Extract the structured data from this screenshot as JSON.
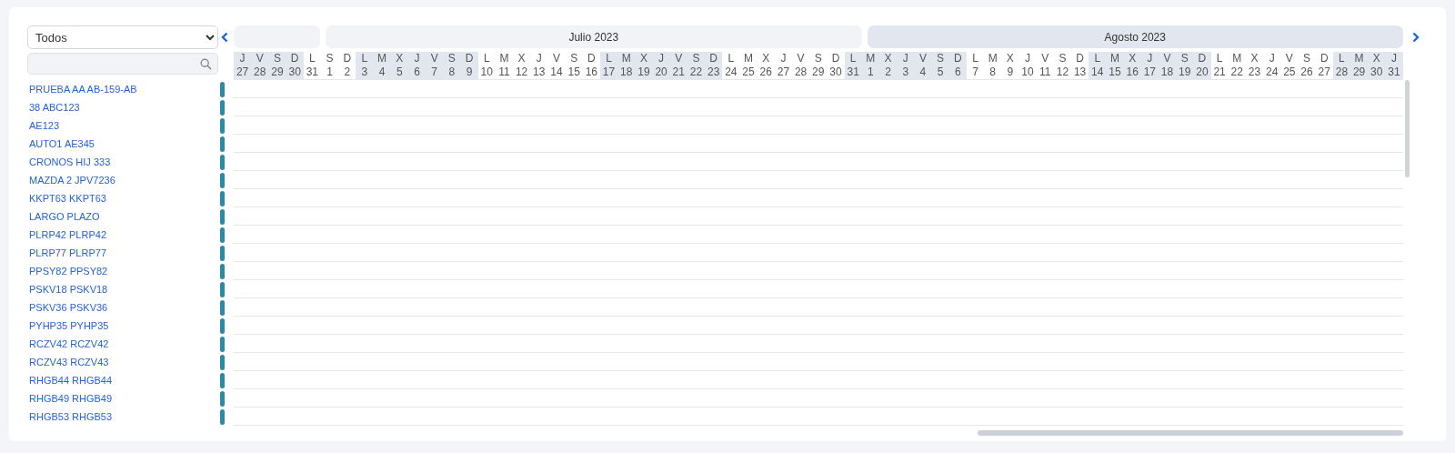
{
  "filter": {
    "value": "Todos"
  },
  "months": [
    {
      "selected": false
    },
    {
      "label": "Julio 2023",
      "selected": false
    },
    {
      "label": "Agosto 2023",
      "selected": true
    }
  ],
  "weeks": [
    {
      "shaded": true,
      "days": [
        {
          "weekday": "J",
          "day": "27"
        },
        {
          "weekday": "V",
          "day": "28"
        },
        {
          "weekday": "S",
          "day": "29"
        },
        {
          "weekday": "D",
          "day": "30"
        }
      ]
    },
    {
      "shaded": false,
      "days": [
        {
          "weekday": "L",
          "day": "31"
        },
        {
          "weekday": "S",
          "day": "1"
        },
        {
          "weekday": "D",
          "day": "2"
        }
      ]
    },
    {
      "shaded": true,
      "days": [
        {
          "weekday": "L",
          "day": "3"
        },
        {
          "weekday": "M",
          "day": "4"
        },
        {
          "weekday": "X",
          "day": "5"
        },
        {
          "weekday": "J",
          "day": "6"
        },
        {
          "weekday": "V",
          "day": "7"
        },
        {
          "weekday": "S",
          "day": "8"
        },
        {
          "weekday": "D",
          "day": "9"
        }
      ]
    },
    {
      "shaded": false,
      "days": [
        {
          "weekday": "L",
          "day": "10"
        },
        {
          "weekday": "M",
          "day": "11"
        },
        {
          "weekday": "X",
          "day": "12"
        },
        {
          "weekday": "J",
          "day": "13"
        },
        {
          "weekday": "V",
          "day": "14"
        },
        {
          "weekday": "S",
          "day": "15"
        },
        {
          "weekday": "D",
          "day": "16"
        }
      ]
    },
    {
      "shaded": true,
      "days": [
        {
          "weekday": "L",
          "day": "17"
        },
        {
          "weekday": "M",
          "day": "18"
        },
        {
          "weekday": "X",
          "day": "19"
        },
        {
          "weekday": "J",
          "day": "20"
        },
        {
          "weekday": "V",
          "day": "21"
        },
        {
          "weekday": "S",
          "day": "22"
        },
        {
          "weekday": "D",
          "day": "23"
        }
      ]
    },
    {
      "shaded": false,
      "days": [
        {
          "weekday": "L",
          "day": "24"
        },
        {
          "weekday": "M",
          "day": "25"
        },
        {
          "weekday": "X",
          "day": "26"
        },
        {
          "weekday": "J",
          "day": "27"
        },
        {
          "weekday": "V",
          "day": "28"
        },
        {
          "weekday": "S",
          "day": "29"
        },
        {
          "weekday": "D",
          "day": "30"
        }
      ]
    },
    {
      "shaded": true,
      "days": [
        {
          "weekday": "L",
          "day": "31"
        },
        {
          "weekday": "M",
          "day": "1"
        },
        {
          "weekday": "X",
          "day": "2"
        },
        {
          "weekday": "J",
          "day": "3"
        },
        {
          "weekday": "V",
          "day": "4"
        },
        {
          "weekday": "S",
          "day": "5"
        },
        {
          "weekday": "D",
          "day": "6"
        }
      ]
    },
    {
      "shaded": false,
      "days": [
        {
          "weekday": "L",
          "day": "7"
        },
        {
          "weekday": "M",
          "day": "8"
        },
        {
          "weekday": "X",
          "day": "9"
        },
        {
          "weekday": "J",
          "day": "10"
        },
        {
          "weekday": "V",
          "day": "11"
        },
        {
          "weekday": "S",
          "day": "12"
        },
        {
          "weekday": "D",
          "day": "13"
        }
      ]
    },
    {
      "shaded": true,
      "days": [
        {
          "weekday": "L",
          "day": "14"
        },
        {
          "weekday": "M",
          "day": "15"
        },
        {
          "weekday": "X",
          "day": "16"
        },
        {
          "weekday": "J",
          "day": "17"
        },
        {
          "weekday": "V",
          "day": "18"
        },
        {
          "weekday": "S",
          "day": "19"
        },
        {
          "weekday": "D",
          "day": "20"
        }
      ]
    },
    {
      "shaded": false,
      "days": [
        {
          "weekday": "L",
          "day": "21"
        },
        {
          "weekday": "M",
          "day": "22"
        },
        {
          "weekday": "X",
          "day": "23"
        },
        {
          "weekday": "J",
          "day": "24"
        },
        {
          "weekday": "V",
          "day": "25"
        },
        {
          "weekday": "S",
          "day": "26"
        },
        {
          "weekday": "D",
          "day": "27"
        }
      ]
    },
    {
      "shaded": true,
      "days": [
        {
          "weekday": "L",
          "day": "28"
        },
        {
          "weekday": "M",
          "day": "29"
        },
        {
          "weekday": "X",
          "day": "30"
        },
        {
          "weekday": "J",
          "day": "31"
        }
      ]
    }
  ],
  "vehicles": [
    {
      "name": "PRUEBA AA AB-159-AB"
    },
    {
      "name": "38 ABC123"
    },
    {
      "name": "AE123"
    },
    {
      "name": "AUTO1 AE345"
    },
    {
      "name": "CRONOS HIJ 333"
    },
    {
      "name": "MAZDA 2 JPV7236"
    },
    {
      "name": "KKPT63 KKPT63"
    },
    {
      "name": "LARGO PLAZO"
    },
    {
      "name": "PLRP42 PLRP42"
    },
    {
      "name": "PLRP77 PLRP77"
    },
    {
      "name": "PPSY82 PPSY82"
    },
    {
      "name": "PSKV18 PSKV18"
    },
    {
      "name": "PSKV36 PSKV36"
    },
    {
      "name": "PYHP35 PYHP35"
    },
    {
      "name": "RCZV42 RCZV42"
    },
    {
      "name": "RCZV43 RCZV43"
    },
    {
      "name": "RHGB44 RHGB44"
    },
    {
      "name": "RHGB49 RHGB49"
    },
    {
      "name": "RHGB53 RHGB53"
    }
  ]
}
